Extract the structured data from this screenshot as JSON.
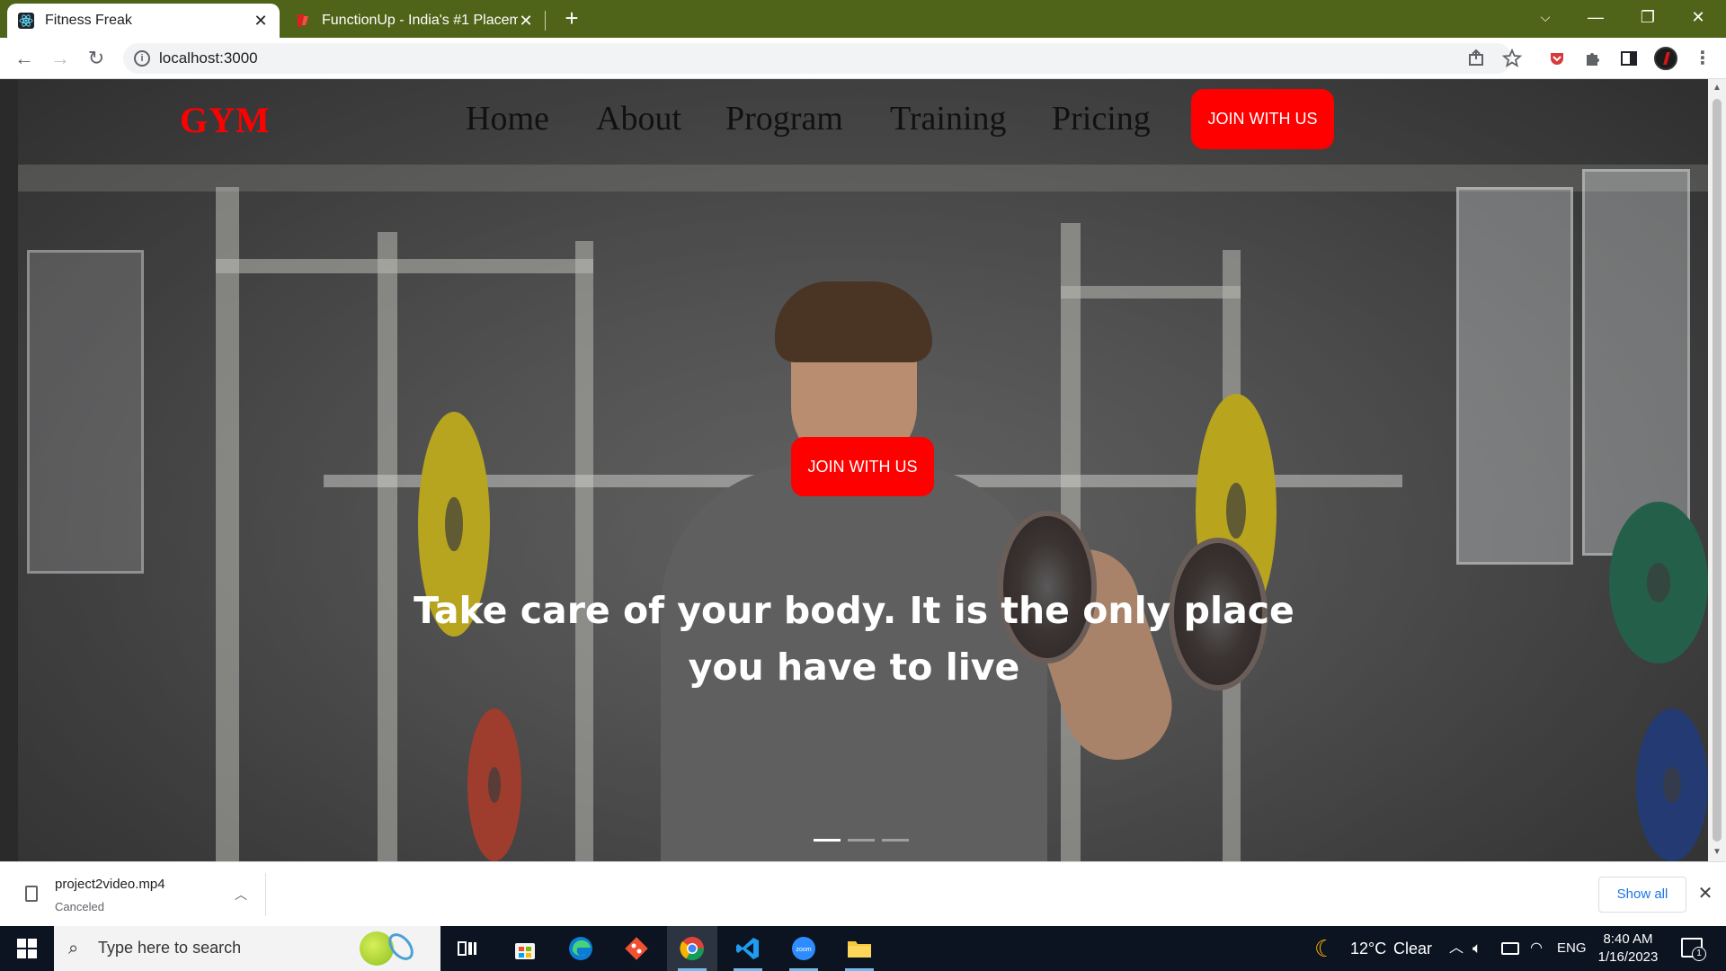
{
  "browser": {
    "tabs": [
      {
        "title": "Fitness Freak",
        "active": true,
        "close": "✕"
      },
      {
        "title": "FunctionUp - India's #1 Placemer",
        "active": false,
        "close": "✕"
      }
    ],
    "new_tab": "+",
    "window_controls": {
      "tab_search": "⌵",
      "minimize": "—",
      "maximize": "❐",
      "close": "✕"
    },
    "nav": {
      "back": "←",
      "forward": "→",
      "reload": "↻"
    },
    "url": "localhost:3000"
  },
  "page": {
    "logo": "GYM",
    "nav_links": [
      "Home",
      "About",
      "Program",
      "Training",
      "Pricing"
    ],
    "header_cta": "JOIN WITH US",
    "hero_cta": "JOIN WITH US",
    "hero_text": "Take care of your body. It is the only place you have to live",
    "carousel": {
      "slides": 3,
      "active": 0
    }
  },
  "download_bar": {
    "file_name": "project2video.mp4",
    "status": "Canceled",
    "show_all": "Show all",
    "close": "✕"
  },
  "taskbar": {
    "search_placeholder": "Type here to search",
    "apps": [
      {
        "name": "task-view",
        "running": false
      },
      {
        "name": "microsoft-store",
        "running": false
      },
      {
        "name": "edge",
        "running": false
      },
      {
        "name": "git",
        "running": false
      },
      {
        "name": "chrome",
        "running": true,
        "active": true
      },
      {
        "name": "vscode",
        "running": true
      },
      {
        "name": "zoom",
        "running": true
      },
      {
        "name": "file-explorer",
        "running": true
      }
    ],
    "weather": {
      "temp": "12°C",
      "condition": "Clear"
    },
    "language": "ENG",
    "time": "8:40 AM",
    "date": "1/16/2023",
    "notifications": "1"
  },
  "colors": {
    "tabstrip": "#4f6418",
    "accent_red": "#ff0000",
    "link_blue": "#1a73e8",
    "taskbar": "#0b1420"
  }
}
